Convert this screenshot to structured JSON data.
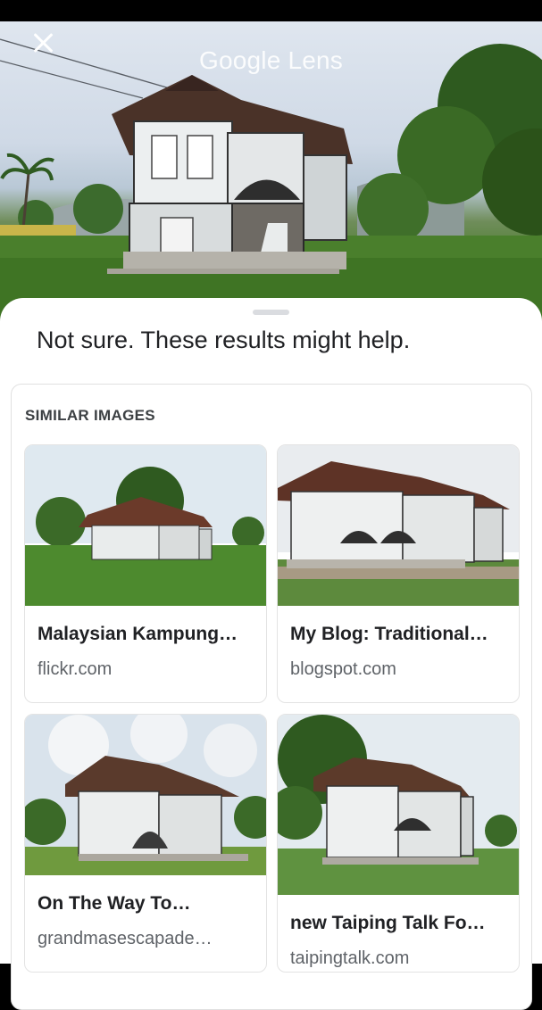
{
  "app": {
    "title": "Google Lens"
  },
  "results": {
    "headline": "Not sure. These results might help.",
    "section_title": "SIMILAR IMAGES",
    "items": [
      {
        "title": "Malaysian Kampung…",
        "source": "flickr.com"
      },
      {
        "title": "My Blog: Traditional…",
        "source": "blogspot.com"
      },
      {
        "title": "On The Way To…",
        "source": "grandmasescapade…"
      },
      {
        "title": "new Taiping Talk Fo…",
        "source": "taipingtalk.com"
      }
    ]
  }
}
